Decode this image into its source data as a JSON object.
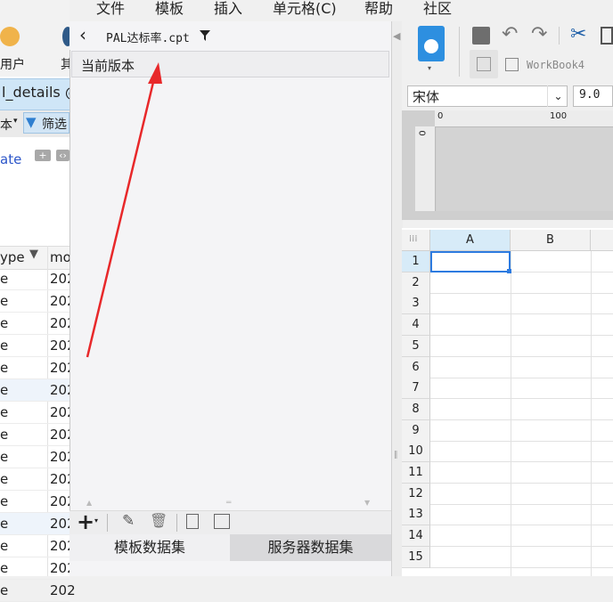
{
  "menubar": {
    "items": [
      "文件",
      "模板",
      "插入",
      "单元格(C)",
      "帮助",
      "社区"
    ]
  },
  "background_app": {
    "user_label": "用户",
    "second_label": "其",
    "tab_text": "l_details @",
    "filter_left": "本",
    "filter_label": "筛选",
    "link_text": "ate",
    "table_headers": [
      "ype",
      "mo"
    ],
    "rows": [
      [
        "e",
        "202"
      ],
      [
        "e",
        "202"
      ],
      [
        "e",
        "202"
      ],
      [
        "e",
        "202"
      ],
      [
        "e",
        "202"
      ],
      [
        "e",
        "202"
      ],
      [
        "e",
        "202"
      ],
      [
        "e",
        "202"
      ],
      [
        "e",
        "202"
      ],
      [
        "e",
        "202"
      ],
      [
        "e",
        "202"
      ],
      [
        "e",
        "202"
      ],
      [
        "e",
        "202"
      ],
      [
        "e",
        "202"
      ],
      [
        "e",
        "202"
      ]
    ]
  },
  "dataset_panel": {
    "file_title": "PAL达标率.cpt",
    "version_label": "当前版本",
    "tabs": [
      "模板数据集",
      "服务器数据集"
    ],
    "active_tab": 0
  },
  "designer": {
    "workbook_label": "WorkBook4",
    "font_name": "宋体",
    "font_size": "9.0",
    "ruler_marks": [
      "0",
      "100"
    ],
    "columns": [
      "A",
      "B"
    ],
    "rows": [
      "1",
      "2",
      "3",
      "4",
      "5",
      "6",
      "7",
      "8",
      "9",
      "10",
      "11",
      "12",
      "13",
      "14",
      "15"
    ],
    "selected_cell": "A1"
  },
  "colors": {
    "accent": "#2d7be0",
    "arrow": "#e8282a",
    "link": "#2c56c9"
  }
}
